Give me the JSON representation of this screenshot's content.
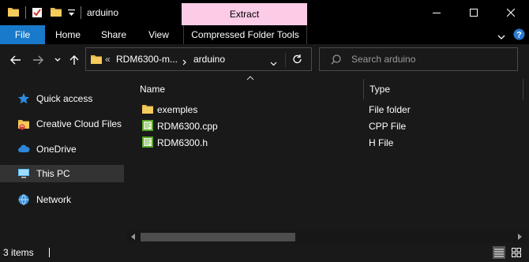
{
  "window": {
    "title": "arduino",
    "contextual_tab": "Extract",
    "contextual_tab_color": "#fccbe6",
    "controls": [
      "minimize",
      "maximize",
      "close"
    ]
  },
  "ribbon": {
    "tabs": [
      {
        "label": "File",
        "active_color": "#1979ca"
      },
      {
        "label": "Home"
      },
      {
        "label": "Share"
      },
      {
        "label": "View"
      },
      {
        "label": "Compressed Folder Tools"
      }
    ]
  },
  "nav": {
    "breadcrumb": {
      "overflow": "«",
      "segments": [
        "RDM6300-m...",
        "arduino"
      ]
    },
    "search_placeholder": "Search arduino"
  },
  "sidebar": {
    "items": [
      {
        "label": "Quick access",
        "icon": "star-icon",
        "selected": false
      },
      {
        "label": "Creative Cloud Files",
        "icon": "creative-cloud-folder-icon",
        "selected": false
      },
      {
        "label": "OneDrive",
        "icon": "cloud-icon",
        "selected": false
      },
      {
        "label": "This PC",
        "icon": "computer-icon",
        "selected": true
      },
      {
        "label": "Network",
        "icon": "network-icon",
        "selected": false
      }
    ]
  },
  "columns": [
    "Name",
    "Type"
  ],
  "files": [
    {
      "name": "exemples",
      "type": "File folder",
      "icon": "folder-icon"
    },
    {
      "name": "RDM6300.cpp",
      "type": "CPP File",
      "icon": "cpp-file-icon"
    },
    {
      "name": "RDM6300.h",
      "type": "H File",
      "icon": "h-file-icon"
    }
  ],
  "status": {
    "item_count": "3 items"
  }
}
